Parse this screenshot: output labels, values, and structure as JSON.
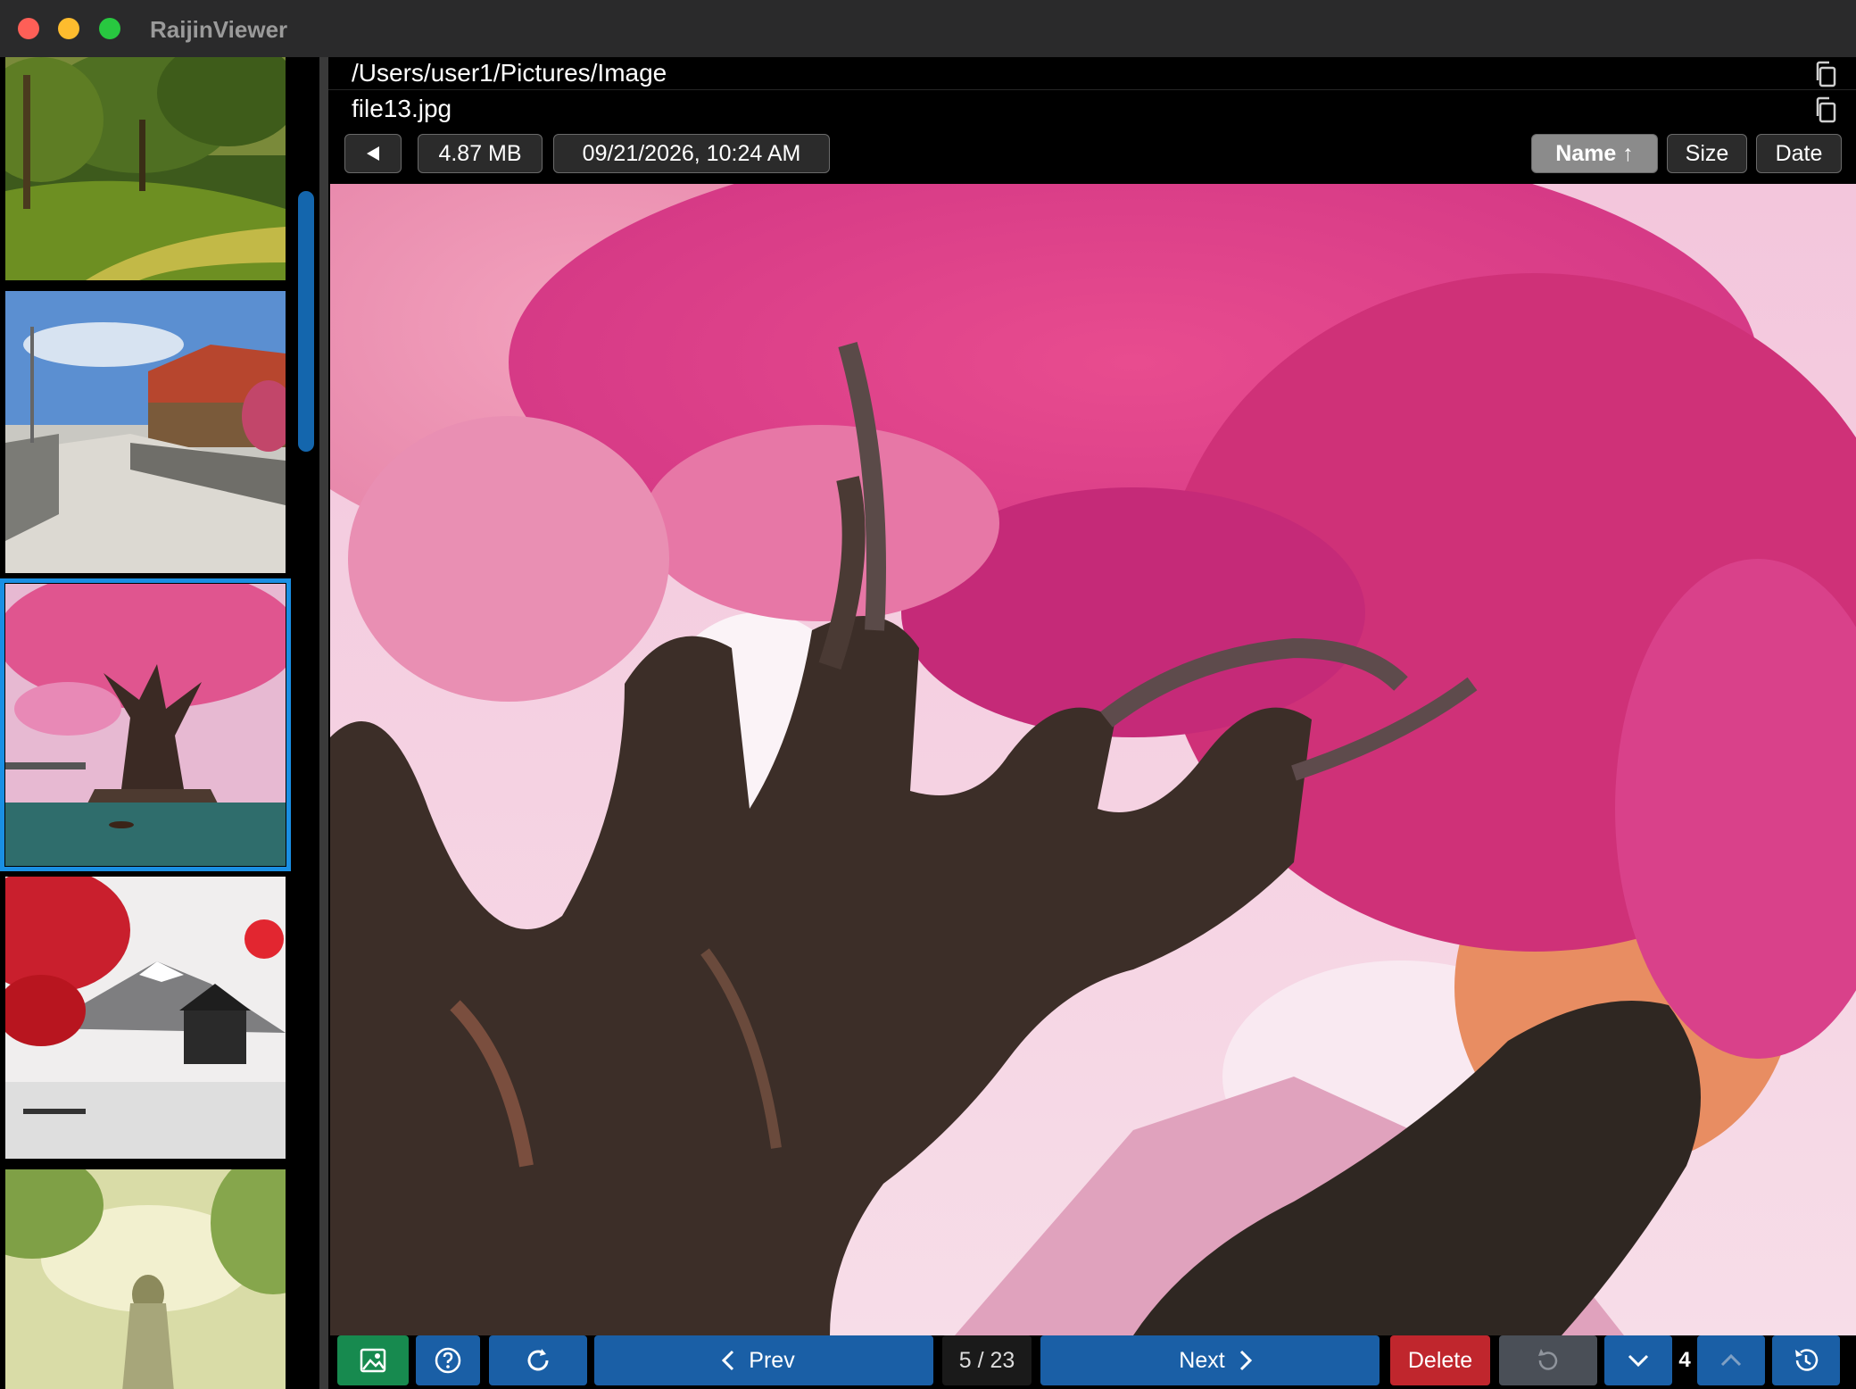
{
  "window": {
    "title": "RaijinViewer"
  },
  "header": {
    "path": "/Users/user1/Pictures/Image",
    "filename": "file13.jpg",
    "copy_path_icon": "copy-icon",
    "copy_filename_icon": "copy-icon"
  },
  "meta": {
    "back_icon": "triangle-left-icon",
    "size": "4.87 MB",
    "date": "09/21/2026, 10:24 AM"
  },
  "sort": {
    "name_label": "Name ↑",
    "size_label": "Size",
    "date_label": "Date",
    "active": "name"
  },
  "sidebar": {
    "thumbnails": [
      {
        "name": "forest-path",
        "selected": false
      },
      {
        "name": "village-street",
        "selected": false
      },
      {
        "name": "cherry-tree",
        "selected": true
      },
      {
        "name": "mount-fuji",
        "selected": false
      },
      {
        "name": "girl-sky",
        "selected": false
      }
    ]
  },
  "bottom": {
    "prev_label": "Prev",
    "counter": "5 / 23",
    "next_label": "Next",
    "delete_label": "Delete",
    "step_value": "4"
  },
  "colors": {
    "accent_blue": "#1a5fa6",
    "selection": "#1a8fe3",
    "delete_red": "#c0262d",
    "gallery_green": "#178a4f"
  }
}
